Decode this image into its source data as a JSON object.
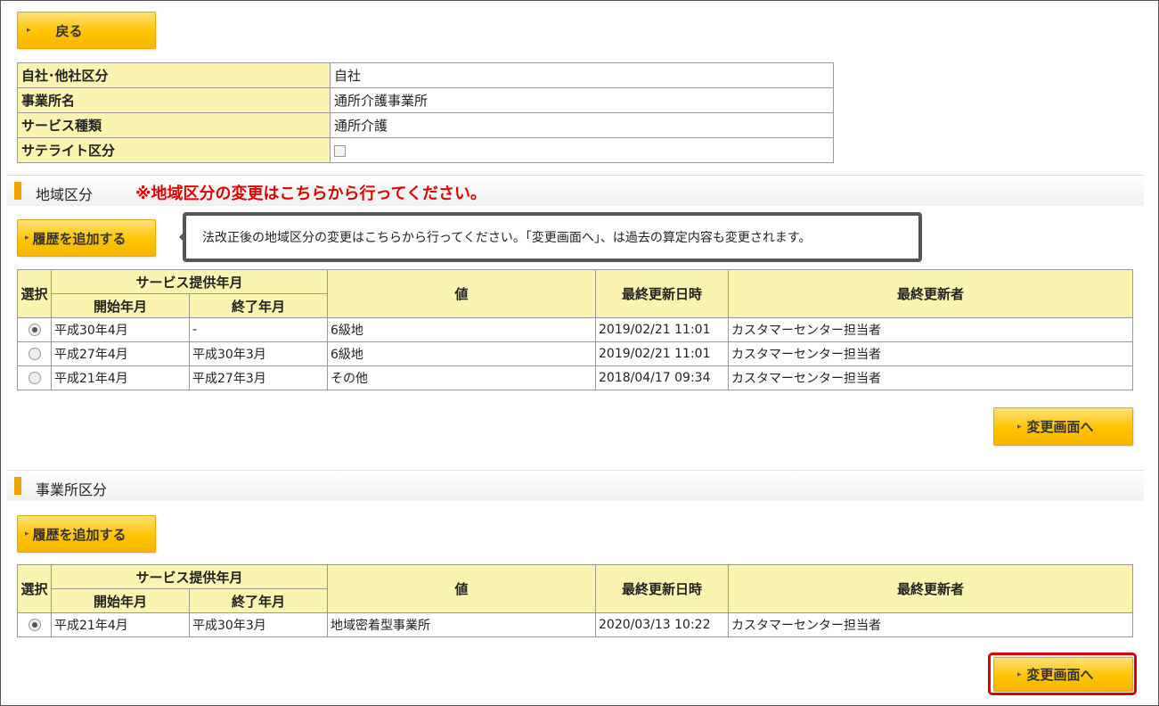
{
  "back_button": "戻る",
  "info_table": [
    {
      "label": "自社･他社区分",
      "value": "自社"
    },
    {
      "label": "事業所名",
      "value": "通所介護事業所"
    },
    {
      "label": "サービス種類",
      "value": "通所介護"
    },
    {
      "label": "サテライト区分",
      "value": ""
    }
  ],
  "region": {
    "title": "地域区分",
    "note": "※地域区分の変更はこちらから行ってください。",
    "add_button": "履歴を追加する",
    "tooltip": "法改正後の地域区分の変更はこちらから行ってください。「変更画面へ」、は過去の算定内容も変更されます。",
    "change_button": "変更画面へ",
    "rows": [
      {
        "selected": true,
        "start": "平成30年4月",
        "end": "-",
        "value": "6級地",
        "updated": "2019/02/21 11:01",
        "updater": "カスタマーセンター担当者"
      },
      {
        "selected": false,
        "start": "平成27年4月",
        "end": "平成30年3月",
        "value": "6級地",
        "updated": "2019/02/21 11:01",
        "updater": "カスタマーセンター担当者"
      },
      {
        "selected": false,
        "start": "平成21年4月",
        "end": "平成27年3月",
        "value": "その他",
        "updated": "2018/04/17 09:34",
        "updater": "カスタマーセンター担当者"
      }
    ]
  },
  "table_headers": {
    "select": "選択",
    "period": "サービス提供年月",
    "start": "開始年月",
    "end": "終了年月",
    "value": "値",
    "updated": "最終更新日時",
    "updater": "最終更新者"
  },
  "office": {
    "title": "事業所区分",
    "add_button": "履歴を追加する",
    "change_button": "変更画面へ",
    "rows": [
      {
        "selected": true,
        "start": "平成21年4月",
        "end": "平成30年3月",
        "value": "地域密着型事業所",
        "updated": "2020/03/13 10:22",
        "updater": "カスタマーセンター担当者"
      }
    ]
  },
  "colors": {
    "button_yellow": "#ffc400",
    "header_yellow": "#fbf3b0",
    "highlight_red": "#e00000",
    "note_red": "#e00000"
  }
}
